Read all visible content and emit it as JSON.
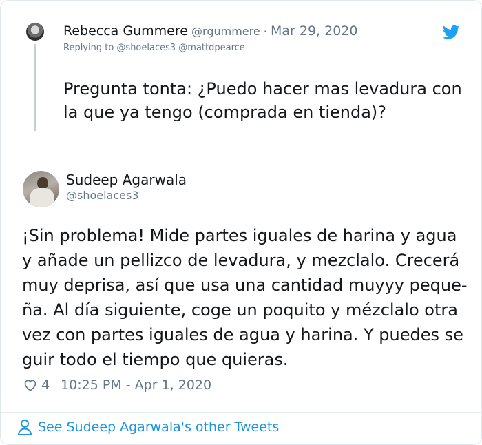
{
  "reply": {
    "name": "Rebecca Gummere",
    "handle": "@rgummere",
    "separator": "·",
    "date": "Mar 29, 2020",
    "replying_to": "Replying to @shoelaces3 @mattdpearce",
    "text": "Pregunta tonta: ¿Puedo hacer mas levadura con la que ya tengo (comprada en tienda)?"
  },
  "tweet": {
    "name": "Sudeep Agarwala",
    "handle": "@shoelaces3",
    "lines": [
      "¡Sin problema! Mide partes iguales de harina y agua",
      "y añade un pellizco de levadura, y mezclalo. Crecerá",
      "muy deprisa, así que usa una cantidad muyyy peque-",
      "ña. Al día siguiente, coge un poquito y mézclalo otra",
      "vez con partes iguales de agua y harina. Y puedes se",
      "guir todo el tiempo que quieras."
    ],
    "likes": "4",
    "timestamp": "10:25 PM - Apr 1, 2020"
  },
  "footer": {
    "see_more": "See Sudeep Agarwala's other Tweets"
  },
  "colors": {
    "link": "#1b95e0",
    "twitter": "#1da1f2",
    "muted": "#657786"
  },
  "icons": {
    "brand": "twitter-bird-icon",
    "like": "heart-icon",
    "profile": "person-icon"
  }
}
